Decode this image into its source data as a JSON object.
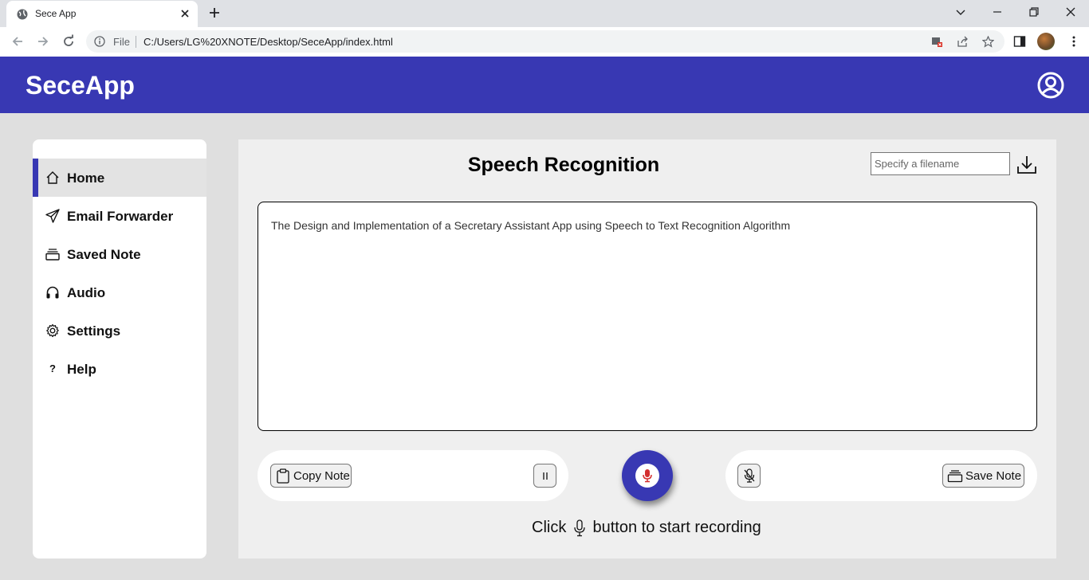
{
  "browser": {
    "tab_title": "Sece App",
    "address_scheme": "File",
    "address_url": "C:/Users/LG%20XNOTE/Desktop/SeceApp/index.html"
  },
  "app": {
    "title": "SeceApp",
    "brand_color": "#3838b3"
  },
  "sidebar": {
    "items": [
      {
        "label": "Home",
        "icon": "home-icon",
        "active": true
      },
      {
        "label": "Email Forwarder",
        "icon": "send-icon",
        "active": false
      },
      {
        "label": "Saved Note",
        "icon": "archive-icon",
        "active": false
      },
      {
        "label": "Audio",
        "icon": "headphones-icon",
        "active": false
      },
      {
        "label": "Settings",
        "icon": "gear-icon",
        "active": false
      },
      {
        "label": "Help",
        "icon": "question-icon",
        "active": false
      }
    ]
  },
  "main": {
    "title": "Speech Recognition",
    "filename_placeholder": "Specify a filename",
    "transcript": "The Design and Implementation of a Secretary Assistant App using Speech to Text Recognition Algorithm",
    "copy_label": "Copy Note",
    "save_label": "Save Note",
    "hint_before": "Click",
    "hint_after": "button to start recording"
  }
}
